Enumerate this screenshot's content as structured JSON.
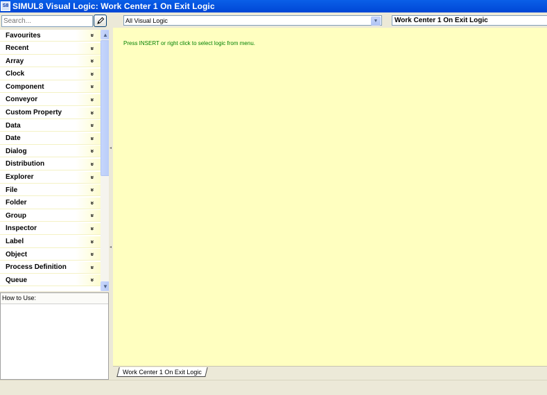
{
  "window": {
    "title": "SIMUL8 Visual Logic: Work Center 1 On Exit Logic",
    "icon_text": "S8"
  },
  "left_panel": {
    "search_placeholder": "Search...",
    "categories": [
      "Favourites",
      "Recent",
      "Array",
      "Clock",
      "Component",
      "Conveyor",
      "Custom Property",
      "Data",
      "Date",
      "Dialog",
      "Distribution",
      "Explorer",
      "File",
      "Folder",
      "Group",
      "Inspector",
      "Label",
      "Object",
      "Process Definition",
      "Queue"
    ],
    "how_to_use_label": "How to Use:"
  },
  "editor": {
    "filter_value": "All Visual Logic",
    "logic_name": "Work Center 1 On Exit Logic",
    "hint": "Press INSERT or right click to select logic from menu.",
    "tab_label": "Work Center 1 On Exit Logic"
  },
  "icons": {
    "search_button": "pencil-icon",
    "expand": "double-chevron-down-icon"
  },
  "colors": {
    "title_bar": "#0a5fe8",
    "editor_background": "#ffffc0",
    "hint_text": "#008000"
  }
}
